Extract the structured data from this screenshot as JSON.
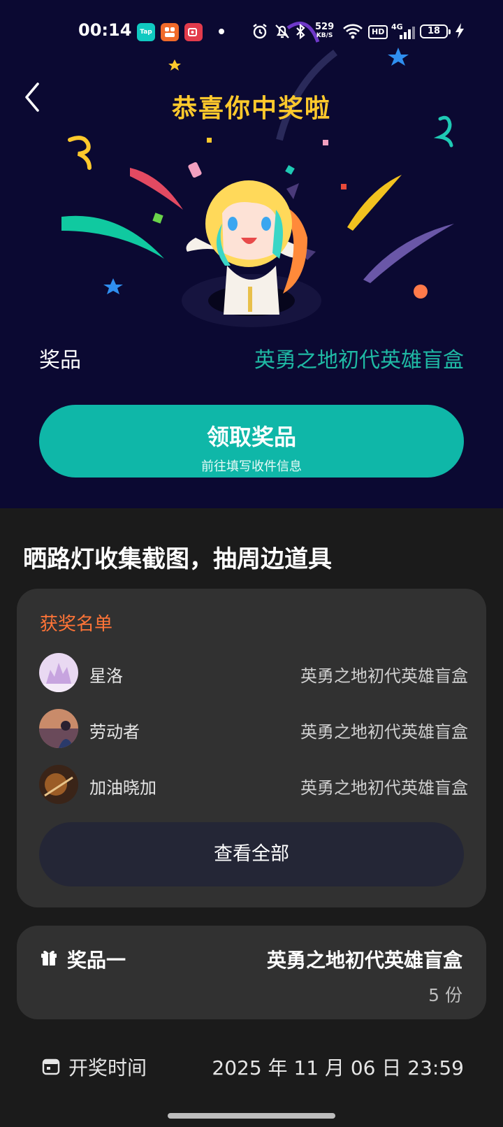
{
  "status_bar": {
    "time": "00:14",
    "apps": [
      {
        "name": "taptap-app-icon",
        "label": "Tap",
        "color": "#10c9c1"
      },
      {
        "name": "game-app-icon",
        "label": "",
        "color": "#f06a2a"
      },
      {
        "name": "recorder-app-icon",
        "label": "",
        "color": "#e23b4c"
      }
    ],
    "net_speed": "529",
    "net_unit": "KB/S",
    "hd": "HD",
    "signal": "4G",
    "battery": "18"
  },
  "header": {
    "title": "恭喜你中奖啦",
    "back_icon": "chevron-left-icon"
  },
  "prize": {
    "label": "奖品",
    "value": "英勇之地初代英雄盲盒"
  },
  "claim_button": {
    "title": "领取奖品",
    "subtitle": "前往填写收件信息"
  },
  "section": {
    "title": "晒路灯收集截图，抽周边道具"
  },
  "winners": {
    "heading": "获奖名单",
    "rows": [
      {
        "name": "星洛",
        "prize": "英勇之地初代英雄盲盒"
      },
      {
        "name": "劳动者",
        "prize": "英勇之地初代英雄盲盒"
      },
      {
        "name": "加油晓加",
        "prize": "英勇之地初代英雄盲盒"
      }
    ],
    "view_all": "查看全部"
  },
  "prize_card": {
    "label": "奖品一",
    "value": "英勇之地初代英雄盲盒",
    "quantity": "5 份"
  },
  "draw_time": {
    "label": "开奖时间",
    "value": "2025 年 11 月 06 日 23:59"
  },
  "colors": {
    "hero_bg": "#0b0932",
    "title": "#ffc92c",
    "teal": "#0fb7a8",
    "prize_text": "#1fb9a4",
    "orange": "#ff7437",
    "card": "#313131"
  }
}
